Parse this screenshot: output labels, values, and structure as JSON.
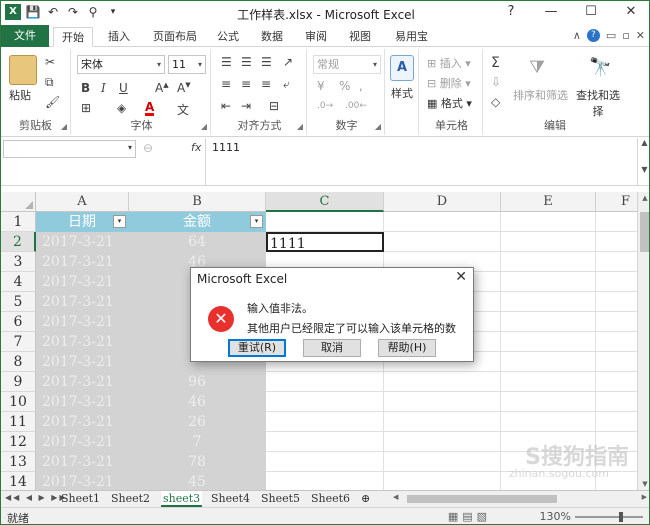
{
  "window": {
    "title": "工作样表.xlsx - Microsoft Excel"
  },
  "tabs": {
    "file": "文件",
    "items": [
      "开始",
      "插入",
      "页面布局",
      "公式",
      "数据",
      "审阅",
      "视图",
      "易用宝"
    ]
  },
  "ribbon": {
    "clipboard": {
      "label": "剪贴板",
      "paste": "粘贴"
    },
    "font": {
      "label": "字体",
      "name": "宋体",
      "size": "11"
    },
    "alignment": {
      "label": "对齐方式"
    },
    "number": {
      "label": "数字",
      "format": "常规"
    },
    "styles": {
      "label": "样式"
    },
    "cells": {
      "label": "单元格",
      "insert": "插入",
      "delete": "删除",
      "format": "格式"
    },
    "editing": {
      "label": "编辑",
      "sort": "排序和筛选",
      "find": "查找和选择"
    }
  },
  "formula_bar": {
    "fx": "fx",
    "value": "1111"
  },
  "grid": {
    "columns": [
      "A",
      "B",
      "C",
      "D",
      "E",
      "F"
    ],
    "rows": [
      "1",
      "2",
      "3",
      "4",
      "5",
      "6",
      "7",
      "8",
      "9",
      "10",
      "11",
      "12",
      "13",
      "14"
    ],
    "header_row": {
      "a": "日期",
      "b": "金额"
    },
    "data": [
      {
        "a": "2017-3-21",
        "b": "64"
      },
      {
        "a": "2017-3-21",
        "b": "46"
      },
      {
        "a": "2017-3-21",
        "b": ""
      },
      {
        "a": "2017-3-21",
        "b": ""
      },
      {
        "a": "2017-3-21",
        "b": ""
      },
      {
        "a": "2017-3-21",
        "b": ""
      },
      {
        "a": "2017-3-21",
        "b": ""
      },
      {
        "a": "2017-3-21",
        "b": "96"
      },
      {
        "a": "2017-3-21",
        "b": "46"
      },
      {
        "a": "2017-3-21",
        "b": "26"
      },
      {
        "a": "2017-3-21",
        "b": "7"
      },
      {
        "a": "2017-3-21",
        "b": "78"
      },
      {
        "a": "2017-3-21",
        "b": "45"
      }
    ],
    "active_cell_value": "1111"
  },
  "sheets": [
    "Sheet1",
    "Sheet2",
    "sheet3",
    "Sheet4",
    "Sheet5",
    "Sheet6"
  ],
  "status": {
    "text": "就绪",
    "zoom": "130%"
  },
  "dialog": {
    "title": "Microsoft Excel",
    "icon": "✕",
    "message1": "输入值非法。",
    "message2": "其他用户已经限定了可以输入该单元格的数值。",
    "retry": "重试(R)",
    "cancel": "取消",
    "help": "帮助(H)"
  },
  "watermark": {
    "main": "S搜狗指南",
    "sub": "zhinan.sogou.com"
  },
  "colors": {
    "accent": "#217346",
    "table_header": "#8fcbdc",
    "data_fill": "#d3d3d3",
    "error": "#e8312c"
  }
}
